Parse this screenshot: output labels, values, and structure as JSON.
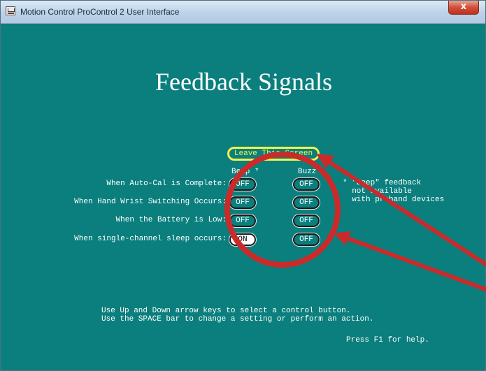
{
  "window": {
    "title": "Motion Control ProControl 2 User Interface",
    "close_glyph": "x"
  },
  "page": {
    "title": "Feedback Signals",
    "leave_button": "Leave This Screen",
    "columns": [
      "Beep",
      "Buzz"
    ],
    "beep_asterisk": "*",
    "rows": [
      {
        "label": "When Auto-Cal is Complete:",
        "beep": "OFF",
        "buzz": "OFF"
      },
      {
        "label": "When Hand Wrist Switching Occurs:",
        "beep": "OFF",
        "buzz": "OFF"
      },
      {
        "label": "When the Battery is Low:",
        "beep": "OFF",
        "buzz": "OFF"
      },
      {
        "label": "When single-channel sleep occurs:",
        "beep": "ON",
        "buzz": "OFF"
      }
    ],
    "note": {
      "asterisk": "*",
      "lines": [
        "\"Beep\" feedback",
        "not available",
        "with prohand devices"
      ]
    },
    "help_lines": [
      "Use Up and Down arrow keys to select a control button.",
      "Use the SPACE bar to change a setting or perform an action."
    ],
    "f1_help": "Press F1 for help."
  },
  "annotation": {
    "color": "#cc2a2a",
    "shapes": [
      "circle-highlight",
      "arrow",
      "arrow"
    ]
  }
}
